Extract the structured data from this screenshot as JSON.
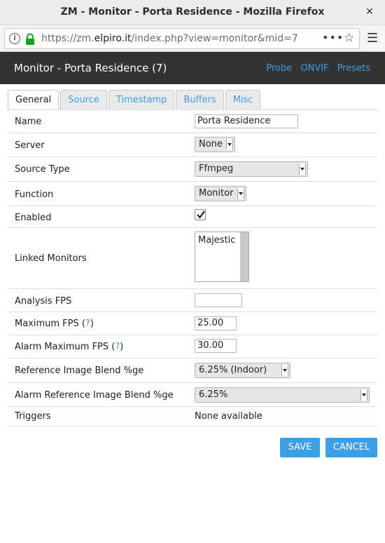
{
  "window": {
    "title": "ZM - Monitor - Porta Residence - Mozilla Firefox",
    "close_glyph": "✕"
  },
  "urlbar": {
    "url_prefix": "https://zm.",
    "url_domain": "elpiro.it",
    "url_suffix": "/index.php?view=monitor&mid=7",
    "more_glyph": "•••",
    "star_glyph": "☆",
    "menu_glyph": "☰",
    "info_glyph": "i"
  },
  "header": {
    "title": "Monitor - Porta Residence (7)",
    "links": [
      "Probe",
      "ONVIF",
      "Presets"
    ]
  },
  "tabs": [
    "General",
    "Source",
    "Timestamp",
    "Buffers",
    "Misc"
  ],
  "active_tab": "General",
  "form": {
    "name_label": "Name",
    "name_value": "Porta Residence",
    "server_label": "Server",
    "server_value": "None",
    "source_type_label": "Source Type",
    "source_type_value": "Ffmpeg",
    "function_label": "Function",
    "function_value": "Monitor",
    "enabled_label": "Enabled",
    "enabled_checked": true,
    "linked_monitors_label": "Linked Monitors",
    "linked_monitors_option": "Majestic",
    "analysis_fps_label": "Analysis FPS",
    "analysis_fps_value": "",
    "max_fps_label": "Maximum FPS",
    "max_fps_value": "25.00",
    "alarm_max_fps_label": "Alarm Maximum FPS",
    "alarm_max_fps_value": "30.00",
    "help_open": "(",
    "help_mark": "?",
    "help_close": ")",
    "ref_blend_label": "Reference Image Blend %ge",
    "ref_blend_value": "6.25% (Indoor)",
    "alarm_ref_blend_label": "Alarm Reference Image Blend %ge",
    "alarm_ref_blend_value": "6.25%",
    "triggers_label": "Triggers",
    "triggers_value": "None available"
  },
  "buttons": {
    "save": "SAVE",
    "cancel": "CANCEL"
  },
  "colors": {
    "accent": "#3c9ee5",
    "header_bg": "#333333"
  }
}
